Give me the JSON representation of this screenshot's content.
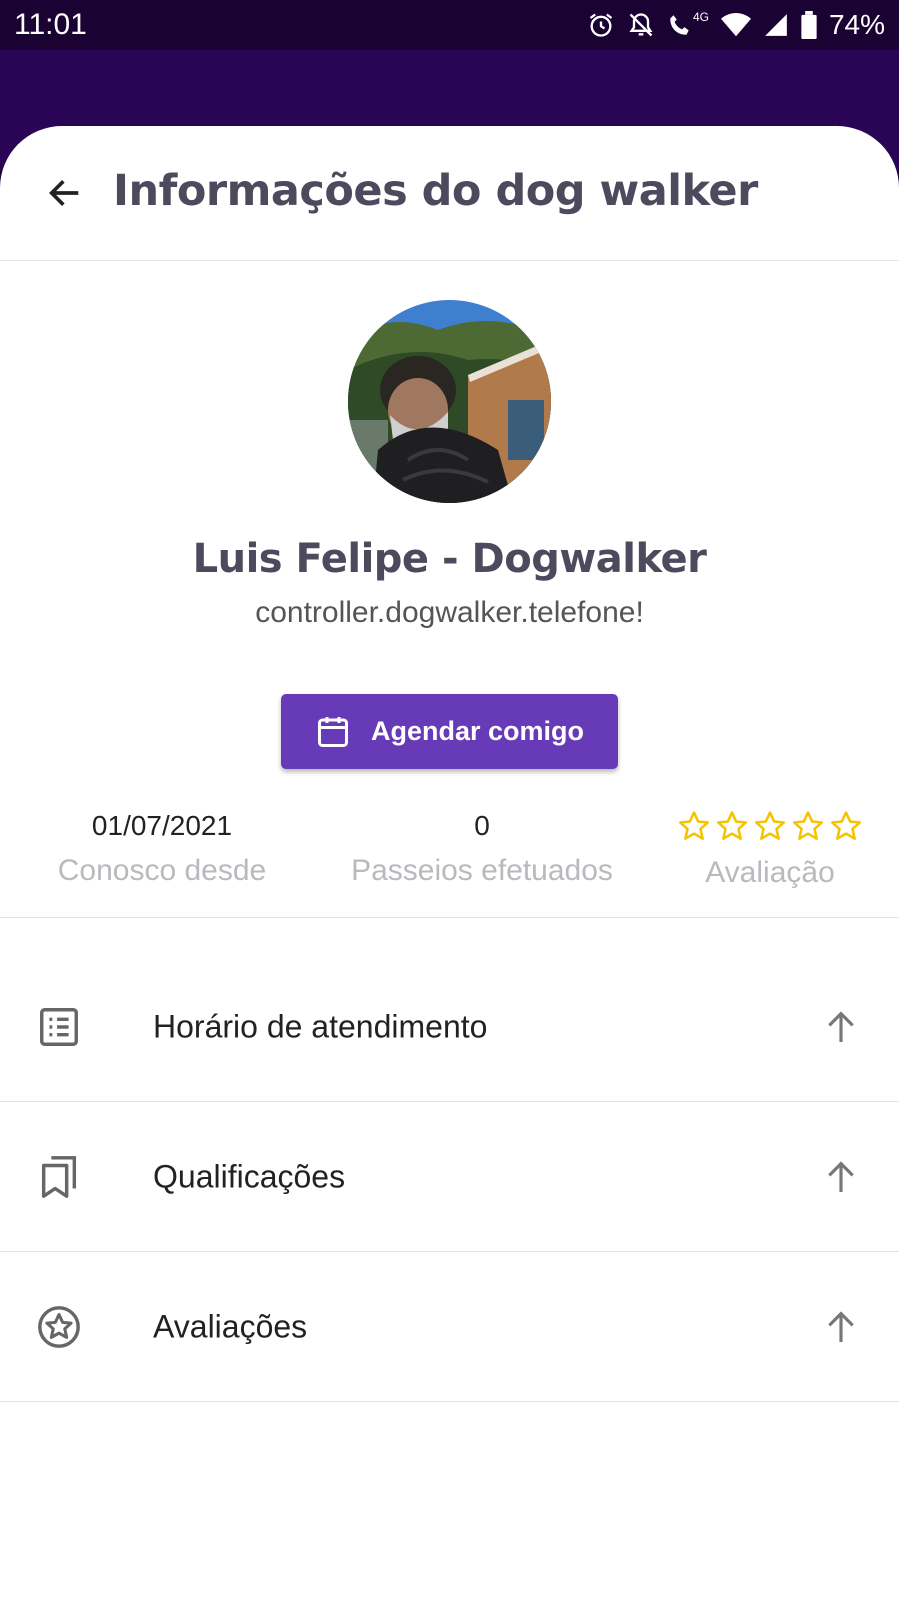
{
  "status_bar": {
    "time": "11:01",
    "network": "4G",
    "battery": "74%",
    "icons": [
      "alarm-icon",
      "notifications-off-icon",
      "wifi-call-icon",
      "wifi-icon",
      "signal-icon",
      "battery-icon"
    ]
  },
  "header": {
    "title": "Informações do dog walker",
    "back_icon": "arrow-left-icon"
  },
  "profile": {
    "name": "Luis Felipe - Dogwalker",
    "phone": "controller.dogwalker.telefone!",
    "schedule_button": "Agendar comigo",
    "schedule_icon": "calendar-icon"
  },
  "stats": {
    "since_value": "01/07/2021",
    "since_label": "Conosco desde",
    "walks_value": "0",
    "walks_label": "Passeios efetuados",
    "rating_label": "Avaliação",
    "rating_stars": 0,
    "rating_max": 5
  },
  "menu": [
    {
      "label": "Horário de atendimento",
      "icon": "list-icon"
    },
    {
      "label": "Qualificações",
      "icon": "bookmarks-icon"
    },
    {
      "label": "Avaliações",
      "icon": "star-circle-icon"
    }
  ],
  "colors": {
    "primary": "#673ab7",
    "app_bar": "#2a0555",
    "status_bar": "#1a0233",
    "title_text": "#4d4a5e",
    "star": "#f5c400"
  }
}
